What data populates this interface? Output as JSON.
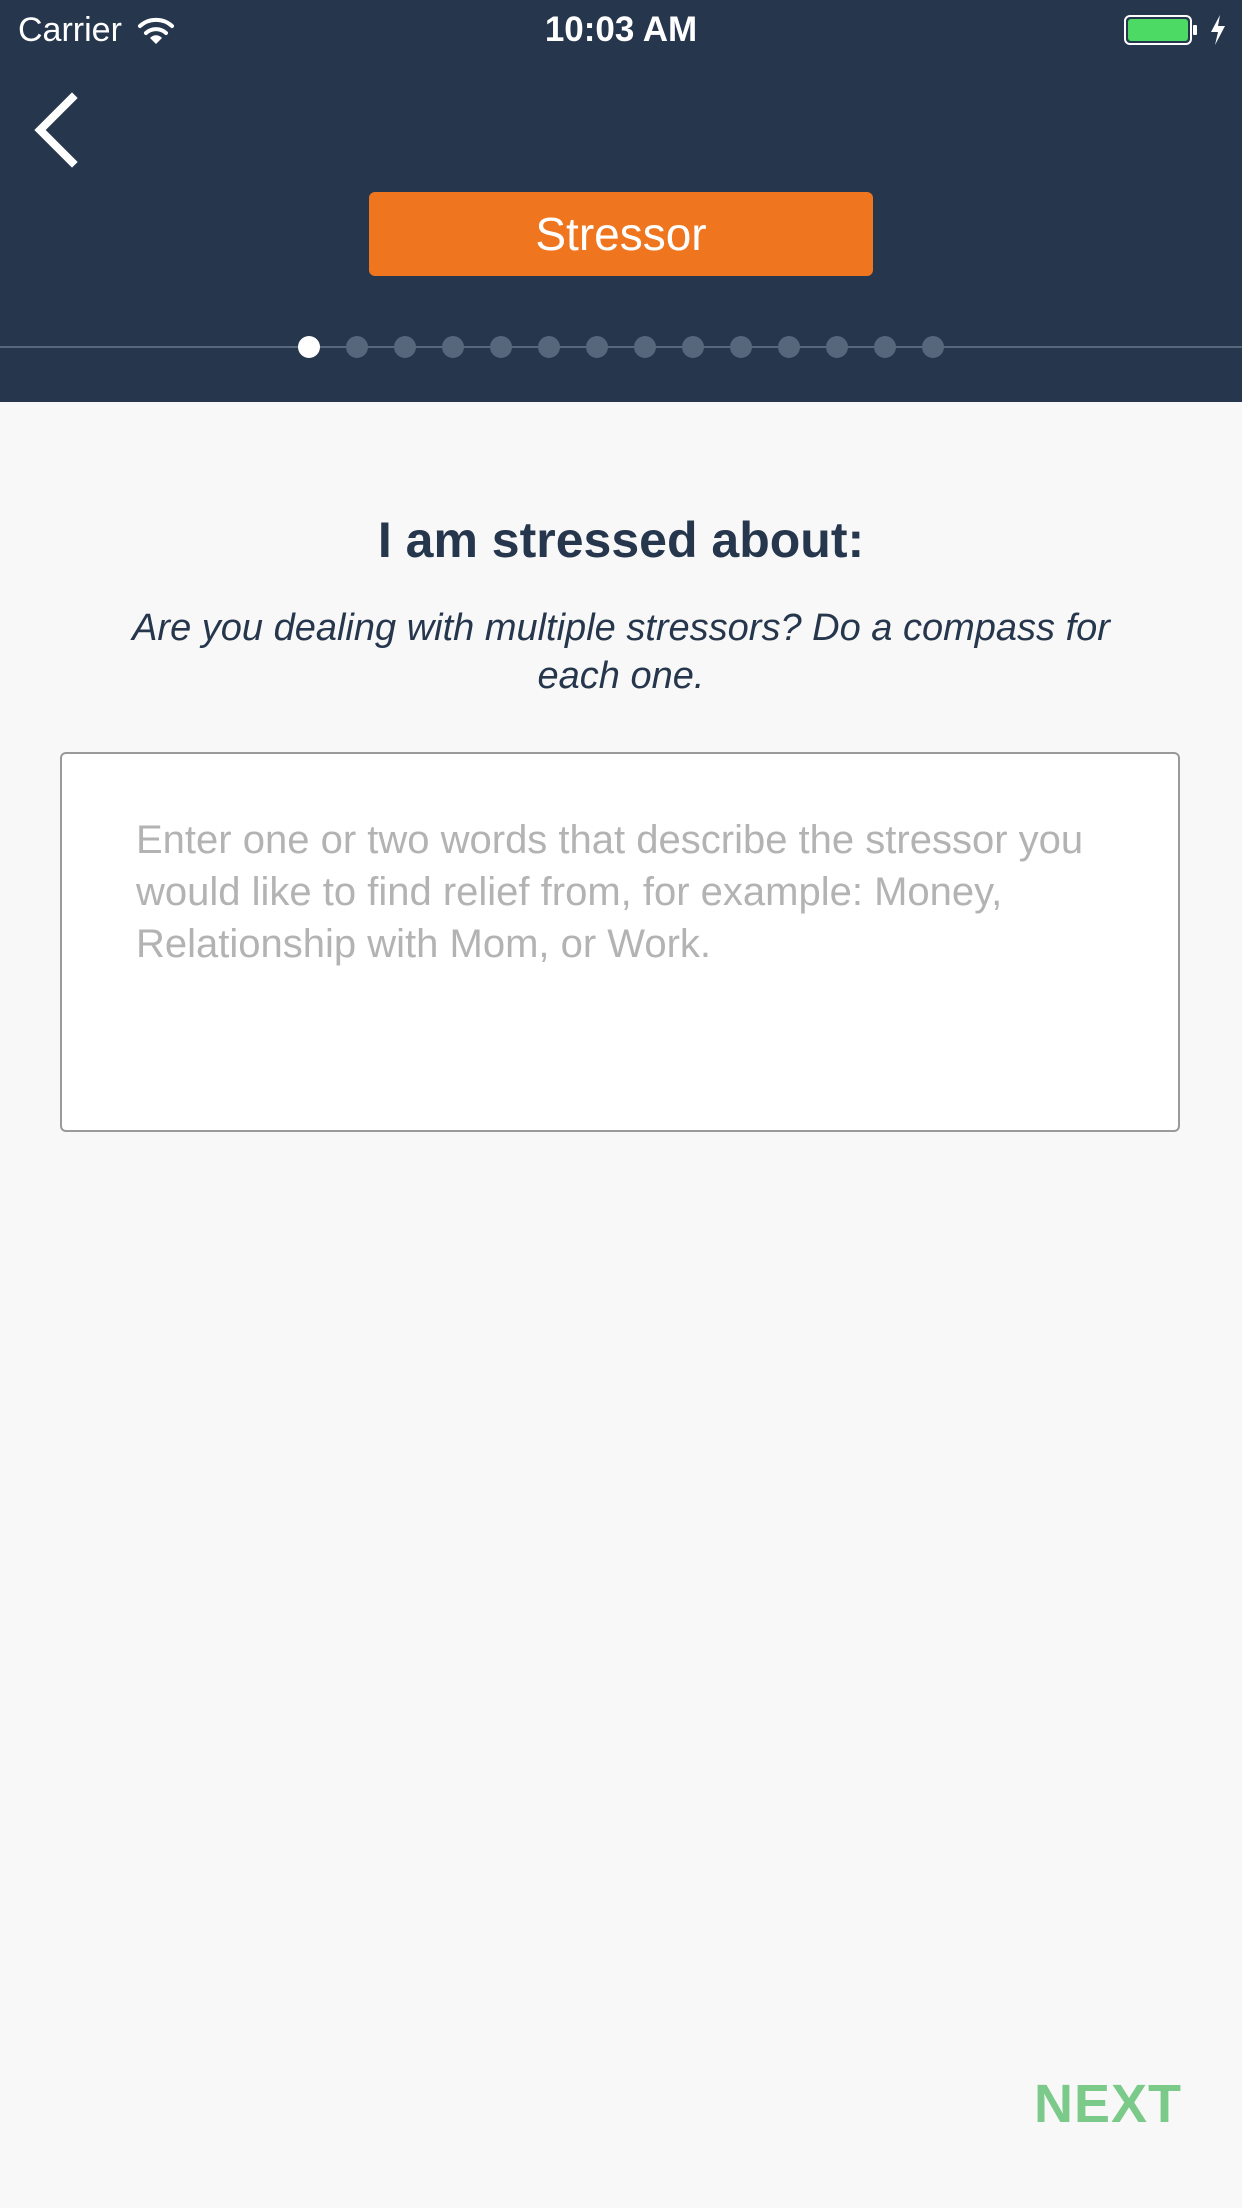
{
  "status_bar": {
    "carrier": "Carrier",
    "time": "10:03 AM",
    "battery_color": "#4cd964"
  },
  "header": {
    "back_icon": "chevron-left-icon",
    "badge_label": "Stressor",
    "badge_color": "#ef761f",
    "background_color": "#26374d",
    "progress": {
      "total_steps": 14,
      "current_step": 1
    }
  },
  "main": {
    "question": "I am stressed about:",
    "hint": "Are you dealing with multiple stressors? Do a compass for each one.",
    "stressor_input": {
      "value": "",
      "placeholder": "Enter one or two words that describe the stressor you would like to find relief from, for example: Money, Relationship with Mom, or Work."
    }
  },
  "footer": {
    "next_label": "NEXT",
    "next_color": "#7cca8a"
  }
}
